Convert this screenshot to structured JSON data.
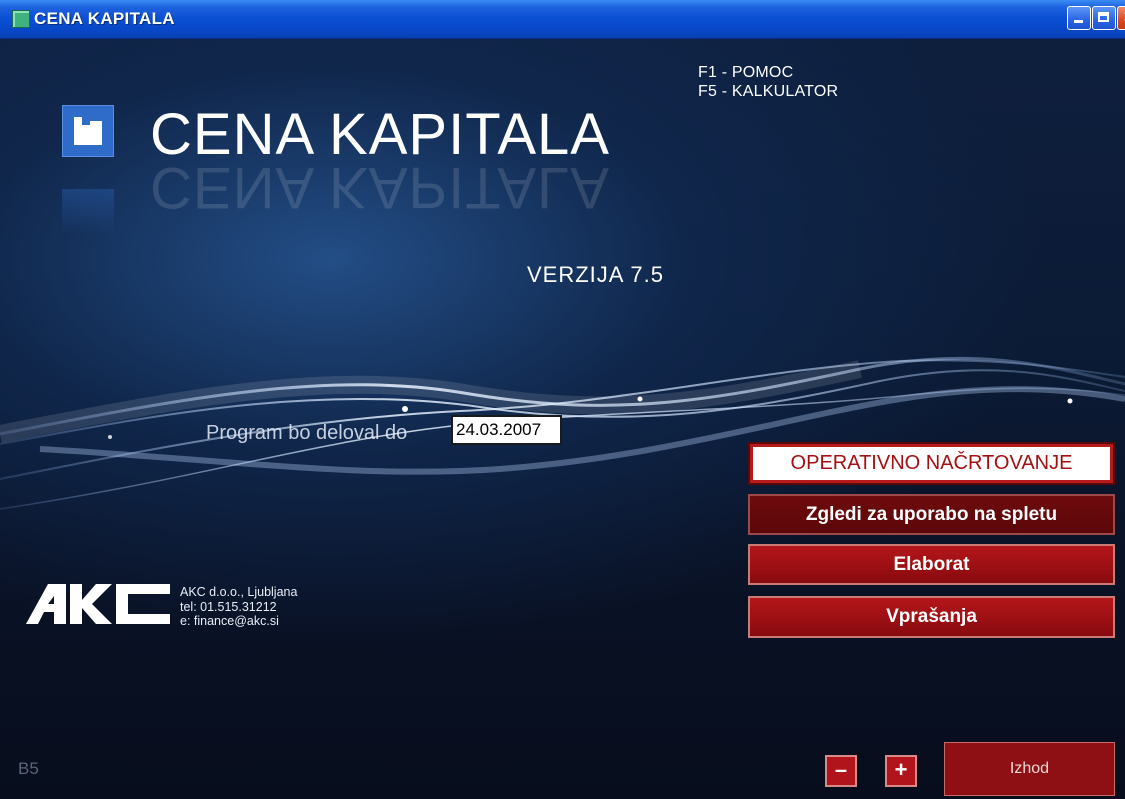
{
  "window": {
    "title": "CENA KAPITALA",
    "buttons": {
      "minimize_icon": "minimize-icon",
      "maximize_icon": "maximize-icon",
      "close_icon": "close-icon"
    }
  },
  "shortcuts": [
    "F1 - POMOC",
    "F5 - KALKULATOR"
  ],
  "brand": {
    "name": "CENA KAPITALA",
    "version": "VERZIJA 7.5",
    "accent": "#2f6bc8"
  },
  "expiry": {
    "label": "Program bo deloval do",
    "date": "24.03.2007"
  },
  "company": {
    "logo_text": "AKC",
    "lines": [
      "AKC d.o.o., Ljubljana",
      "tel: 01.515.31212",
      "e: finance@akc.si"
    ]
  },
  "menu": [
    {
      "label": "OPERATIVNO NAČRTOVANJE"
    },
    {
      "label": "Zgledi za uporabo na spletu"
    },
    {
      "label": "Elaborat"
    },
    {
      "label": "Vprašanja"
    }
  ],
  "footer": {
    "build": "B5",
    "minus_label": "–",
    "plus_label": "+",
    "exit_label": "Izhod"
  },
  "colors": {
    "button_red": "#9a0f13",
    "title_blue": "#0a4fd3"
  }
}
